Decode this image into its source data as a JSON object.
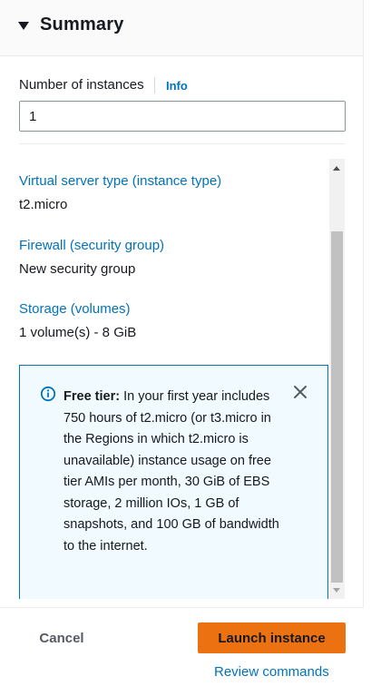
{
  "summary": {
    "title": "Summary"
  },
  "instances": {
    "label": "Number of instances",
    "info_label": "Info",
    "value": "1"
  },
  "details": [
    {
      "link": "Virtual server type (instance type)",
      "value": "t2.micro"
    },
    {
      "link": "Firewall (security group)",
      "value": "New security group"
    },
    {
      "link": "Storage (volumes)",
      "value": "1 volume(s) - 8 GiB"
    }
  ],
  "free_tier_alert": {
    "heading": "Free tier:",
    "body": " In your first year includes 750 hours of t2.micro (or t3.micro in the Regions in which t2.micro is unavailable) instance usage on free tier AMIs per month, 30 GiB of EBS storage, 2 million IOs, 1 GB of snapshots, and 100 GB of bandwidth to the internet."
  },
  "footer": {
    "cancel_label": "Cancel",
    "launch_label": "Launch instance",
    "review_label": "Review commands"
  },
  "colors": {
    "link": "#0073bb",
    "primary_button": "#ec7211",
    "alert_bg": "#f1faff",
    "alert_border": "#0073bb"
  },
  "icons": {
    "collapse": "caret-down-icon",
    "alert": "info-circle-icon",
    "dismiss": "close-icon"
  }
}
